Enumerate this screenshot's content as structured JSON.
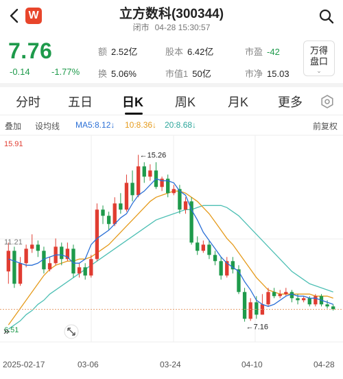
{
  "header": {
    "logo_text": "W",
    "title": "立方数科(300344)",
    "status": "闭市",
    "datetime": "04-28 15:30:57"
  },
  "quote": {
    "price": "7.76",
    "change": "-0.14",
    "change_pct": "-1.77%",
    "stats": [
      {
        "label": "额",
        "value": "2.52亿"
      },
      {
        "label": "股本",
        "value": "6.42亿"
      },
      {
        "label": "市盈",
        "value": "-42"
      },
      {
        "label": "换",
        "value": "5.06%"
      },
      {
        "label": "市值1",
        "value": "50亿"
      },
      {
        "label": "市净",
        "value": "15.03"
      }
    ],
    "wande_line1": "万得",
    "wande_line2": "盘口"
  },
  "tabs": [
    "分时",
    "五日",
    "日K",
    "周K",
    "月K",
    "更多"
  ],
  "active_tab": "日K",
  "toolbar": {
    "overlay": "叠加",
    "draw": "设均线",
    "ma5": "MA5:8.12↓",
    "ma10": "10:8.36↓",
    "ma20": "20:8.68↓",
    "adjust": "前复权"
  },
  "chart_data": {
    "type": "candlestick",
    "ylim": [
      6.51,
      15.91
    ],
    "y_labels": [
      "15.91",
      "11.21",
      "6.51"
    ],
    "x_labels": [
      "2025-02-17",
      "03-06",
      "03-24",
      "04-10",
      "04-28"
    ],
    "annotations": [
      {
        "text": "←15.26",
        "value": 15.26
      },
      {
        "text": "←7.16",
        "value": 7.16
      }
    ],
    "reference_price": 7.76,
    "colors": {
      "up": "#e03c31",
      "down": "#1e9a4b",
      "ma5": "#2a6fd6",
      "ma10": "#e59a1a",
      "ma20": "#4dbfb4"
    },
    "candles": [
      [
        9.6,
        10.6,
        11.0,
        9.0
      ],
      [
        10.6,
        9.0,
        10.8,
        8.8
      ],
      [
        9.0,
        10.0,
        10.3,
        8.9
      ],
      [
        10.0,
        10.7,
        10.9,
        9.8
      ],
      [
        10.7,
        10.9,
        11.4,
        10.5
      ],
      [
        10.9,
        10.6,
        11.1,
        10.3
      ],
      [
        10.6,
        9.7,
        10.8,
        9.5
      ],
      [
        9.7,
        10.0,
        10.3,
        9.6
      ],
      [
        10.0,
        10.8,
        11.2,
        9.9
      ],
      [
        10.8,
        10.2,
        11.0,
        9.9
      ],
      [
        10.2,
        10.7,
        11.0,
        10.1
      ],
      [
        10.7,
        9.5,
        10.9,
        9.3
      ],
      [
        9.5,
        9.8,
        10.0,
        9.3
      ],
      [
        9.8,
        9.4,
        10.0,
        9.2
      ],
      [
        9.4,
        10.2,
        10.4,
        9.3
      ],
      [
        10.2,
        12.6,
        12.9,
        10.1
      ],
      [
        12.6,
        12.3,
        12.8,
        11.9
      ],
      [
        12.3,
        11.9,
        12.5,
        11.6
      ],
      [
        11.9,
        12.9,
        13.2,
        11.8
      ],
      [
        12.9,
        12.6,
        13.4,
        12.4
      ],
      [
        12.6,
        13.9,
        14.3,
        12.5
      ],
      [
        13.9,
        13.3,
        14.5,
        13.0
      ],
      [
        13.3,
        14.7,
        15.26,
        13.2
      ],
      [
        14.7,
        14.2,
        14.9,
        13.9
      ],
      [
        14.2,
        14.5,
        14.8,
        14.0
      ],
      [
        14.5,
        13.7,
        14.9,
        13.6
      ],
      [
        13.7,
        14.1,
        14.2,
        13.5
      ],
      [
        14.1,
        13.4,
        14.3,
        13.2
      ],
      [
        13.4,
        13.6,
        13.8,
        13.3
      ],
      [
        13.6,
        12.6,
        13.8,
        12.4
      ],
      [
        12.6,
        13.0,
        13.2,
        12.4
      ],
      [
        13.0,
        11.0,
        13.2,
        10.9
      ],
      [
        11.0,
        10.6,
        11.3,
        10.4
      ],
      [
        10.6,
        10.9,
        11.1,
        10.5
      ],
      [
        10.9,
        10.4,
        11.1,
        10.2
      ],
      [
        10.4,
        10.1,
        10.6,
        9.9
      ],
      [
        10.1,
        9.4,
        10.3,
        9.2
      ],
      [
        9.4,
        10.1,
        10.3,
        9.3
      ],
      [
        10.1,
        9.7,
        10.3,
        9.5
      ],
      [
        9.7,
        8.6,
        9.9,
        8.5
      ],
      [
        8.6,
        7.3,
        8.8,
        7.16
      ],
      [
        7.3,
        8.1,
        8.3,
        7.2
      ],
      [
        8.1,
        7.5,
        8.4,
        7.3
      ],
      [
        7.5,
        8.0,
        8.5,
        7.5
      ],
      [
        8.0,
        8.6,
        8.8,
        7.9
      ],
      [
        8.6,
        8.4,
        8.8,
        8.3
      ],
      [
        8.4,
        8.5,
        8.7,
        8.3
      ],
      [
        8.5,
        8.6,
        8.8,
        8.4
      ],
      [
        8.6,
        8.3,
        8.7,
        8.1
      ],
      [
        8.3,
        8.2,
        8.5,
        8.0
      ],
      [
        8.2,
        8.3,
        8.4,
        8.1
      ],
      [
        8.3,
        8.0,
        8.4,
        7.9
      ],
      [
        8.0,
        8.4,
        8.5,
        7.9
      ],
      [
        8.4,
        8.0,
        8.5,
        7.9
      ],
      [
        8.0,
        7.9,
        8.2,
        7.8
      ],
      [
        7.9,
        7.76,
        8.0,
        7.7
      ]
    ],
    "ma5_values": [
      10.2,
      10.1,
      10.0,
      9.9,
      9.9,
      10.0,
      10.2,
      10.3,
      10.4,
      10.4,
      10.3,
      10.0,
      10.0,
      10.2,
      10.9,
      11.2,
      11.4,
      11.6,
      11.9,
      12.2,
      12.4,
      12.9,
      13.3,
      13.5,
      13.8,
      14.1,
      14.0,
      14.0,
      13.9,
      13.5,
      13.3,
      12.6,
      12.1,
      11.5,
      11.1,
      10.7,
      10.3,
      10.0,
      9.8,
      9.6,
      9.1,
      8.7,
      8.2,
      8.0,
      7.9,
      8.0,
      8.2,
      8.4,
      8.5,
      8.4,
      8.4,
      8.3,
      8.3,
      8.2,
      8.1,
      8.0
    ],
    "ma10_values": [
      7.0,
      7.4,
      7.8,
      8.2,
      8.6,
      9.0,
      9.4,
      9.7,
      9.9,
      10.0,
      10.1,
      10.1,
      10.2,
      10.2,
      10.3,
      10.5,
      10.7,
      10.9,
      11.2,
      11.5,
      11.8,
      12.1,
      12.4,
      12.7,
      13.0,
      13.2,
      13.3,
      13.4,
      13.5,
      13.5,
      13.4,
      13.2,
      13.0,
      12.7,
      12.4,
      12.0,
      11.6,
      11.2,
      10.9,
      10.5,
      10.1,
      9.7,
      9.3,
      9.0,
      8.7,
      8.6,
      8.5,
      8.5,
      8.5,
      8.5,
      8.5,
      8.5,
      8.4,
      8.4,
      8.4,
      8.3
    ],
    "ma20_values": [
      6.8,
      7.0,
      7.2,
      7.5,
      7.7,
      8.0,
      8.2,
      8.5,
      8.7,
      8.9,
      9.1,
      9.3,
      9.5,
      9.7,
      9.9,
      10.1,
      10.3,
      10.5,
      10.7,
      10.9,
      11.1,
      11.3,
      11.5,
      11.7,
      11.9,
      12.1,
      12.2,
      12.3,
      12.4,
      12.5,
      12.6,
      12.6,
      12.7,
      12.8,
      12.8,
      12.8,
      12.8,
      12.7,
      12.5,
      12.3,
      12.0,
      11.7,
      11.4,
      11.1,
      10.8,
      10.5,
      10.2,
      9.9,
      9.6,
      9.4,
      9.2,
      9.0,
      8.9,
      8.8,
      8.7,
      8.6
    ]
  }
}
